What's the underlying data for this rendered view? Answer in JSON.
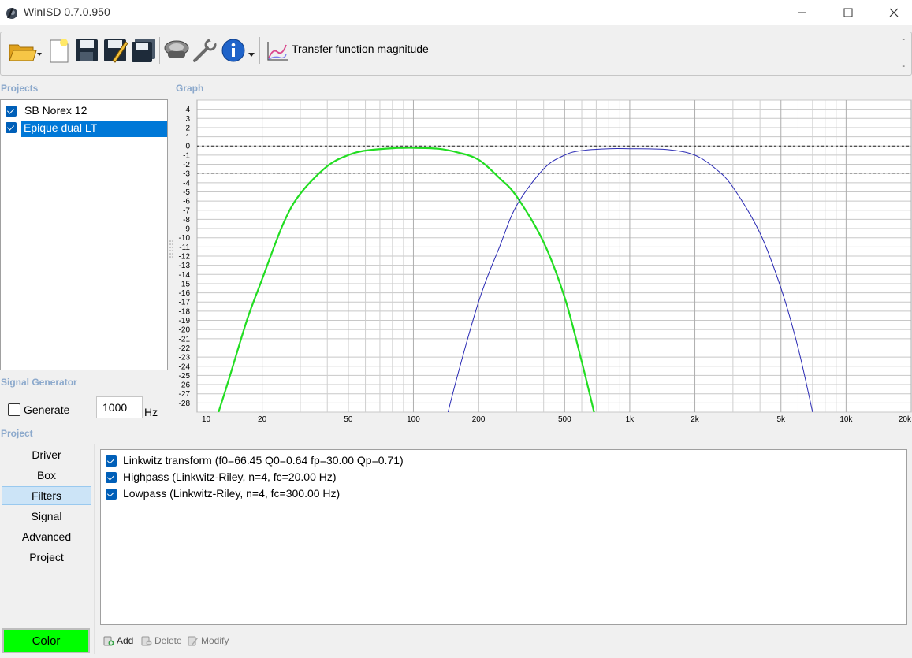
{
  "window": {
    "title": "WinISD 0.7.0.950"
  },
  "toolbar": {
    "view_label": "Transfer function magnitude",
    "icons": [
      "open-folder-icon",
      "new-project-icon",
      "save-icon",
      "save-as-icon",
      "save-all-icon",
      "driver-editor-icon",
      "tools-icon",
      "info-icon",
      "graph-view-icon"
    ],
    "dash_top": "-",
    "dash_bottom": "-"
  },
  "projects": {
    "section_label": "Projects",
    "items": [
      {
        "label": "SB Norex 12",
        "checked": true,
        "selected": false
      },
      {
        "label": "Epique dual LT",
        "checked": true,
        "selected": true
      }
    ]
  },
  "graph": {
    "section_label": "Graph"
  },
  "chart_data": {
    "type": "line",
    "title": "",
    "xlabel": "",
    "ylabel": "",
    "x_scale": "log",
    "xlim": [
      10,
      20000
    ],
    "ylim": [
      -29,
      5
    ],
    "grid": true,
    "x_ticks": [
      "10",
      "20",
      "50",
      "100",
      "200",
      "500",
      "1k",
      "2k",
      "5k",
      "10k",
      "20k"
    ],
    "y_ticks": [
      "4",
      "3",
      "2",
      "1",
      "0",
      "-1",
      "-2",
      "-3",
      "-4",
      "-5",
      "-6",
      "-7",
      "-8",
      "-9",
      "-10",
      "-11",
      "-12",
      "-13",
      "-14",
      "-15",
      "-16",
      "-17",
      "-18",
      "-19",
      "-20",
      "-21",
      "-22",
      "-23",
      "-24",
      "-25",
      "-26",
      "-27",
      "-28"
    ],
    "reference_lines": [
      0,
      -3
    ],
    "series": [
      {
        "color": "#22dd22",
        "x": [
          12,
          14,
          17,
          20,
          25,
          30,
          40,
          50,
          60,
          80,
          100,
          130,
          160,
          200,
          250,
          300,
          400,
          500,
          600,
          700
        ],
        "y": [
          -30.5,
          -25.5,
          -19,
          -14.5,
          -8.5,
          -5.2,
          -2.2,
          -1.0,
          -0.5,
          -0.25,
          -0.2,
          -0.3,
          -0.7,
          -1.5,
          -3.5,
          -5.5,
          -10.5,
          -16.5,
          -23.5,
          -30
        ]
      },
      {
        "color": "#2a2ab4",
        "x": [
          130,
          150,
          200,
          250,
          300,
          400,
          500,
          600,
          800,
          1000,
          1500,
          2000,
          2500,
          3000,
          4000,
          5000,
          6000,
          7000
        ],
        "y": [
          -34,
          -27.5,
          -17,
          -11,
          -6.5,
          -2.5,
          -1.0,
          -0.5,
          -0.3,
          -0.3,
          -0.4,
          -1.0,
          -2.5,
          -4.5,
          -9.5,
          -15.5,
          -22,
          -29
        ]
      }
    ]
  },
  "signal_generator": {
    "section_label": "Signal Generator",
    "generate_label": "Generate",
    "generate_checked": false,
    "frequency": "1000",
    "unit": "Hz"
  },
  "project": {
    "section_label": "Project",
    "nav": [
      "Driver",
      "Box",
      "Filters",
      "Signal",
      "Advanced",
      "Project"
    ],
    "selected": "Filters",
    "color_label": "Color",
    "color_value": "#00ff00"
  },
  "filters": {
    "items": [
      {
        "label": "Linkwitz transform (f0=66.45 Q0=0.64 fp=30.00 Qp=0.71)",
        "checked": true
      },
      {
        "label": "Highpass (Linkwitz-Riley, n=4, fc=20.00 Hz)",
        "checked": true
      },
      {
        "label": "Lowpass (Linkwitz-Riley, n=4, fc=300.00 Hz)",
        "checked": true
      }
    ],
    "actions": {
      "add": "Add",
      "delete": "Delete",
      "modify": "Modify"
    }
  }
}
